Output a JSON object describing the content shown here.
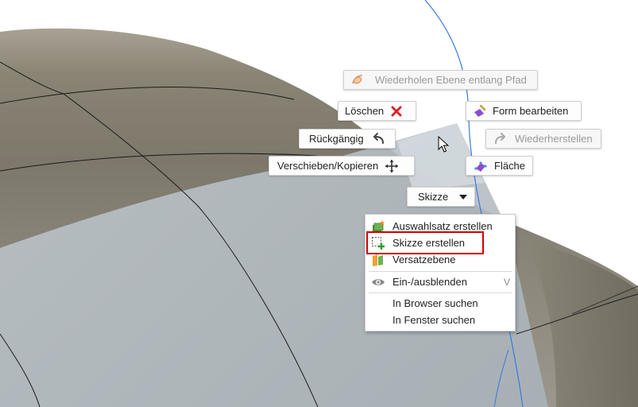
{
  "marking_menu": {
    "repeat_label": "Wiederholen Ebene entlang Pfad",
    "delete_label": "Löschen",
    "edit_form_label": "Form bearbeiten",
    "undo_label": "Rückgängig",
    "redo_label": "Wiederherstellen",
    "move_copy_label": "Verschieben/Kopieren",
    "face_label": "Fläche",
    "sketch_label": "Skizze"
  },
  "context_menu": {
    "items": [
      {
        "label": "Auswahlsatz erstellen",
        "icon": "selection-set-icon"
      },
      {
        "label": "Skizze erstellen",
        "icon": "create-sketch-icon"
      },
      {
        "label": "Versatzebene",
        "icon": "offset-plane-icon"
      },
      {
        "label": "Ein-/ausblenden",
        "icon": "eye-icon",
        "shortcut": "V"
      },
      {
        "label": "In Browser suchen"
      },
      {
        "label": "In Fenster suchen"
      }
    ]
  },
  "colors": {
    "surface": "#8c8676",
    "plane": "#b4bec5",
    "path_line": "#3a78e0",
    "highlight": "#d00000",
    "delete_icon": "#e0202a",
    "purple_icon": "#8a4fd0"
  }
}
